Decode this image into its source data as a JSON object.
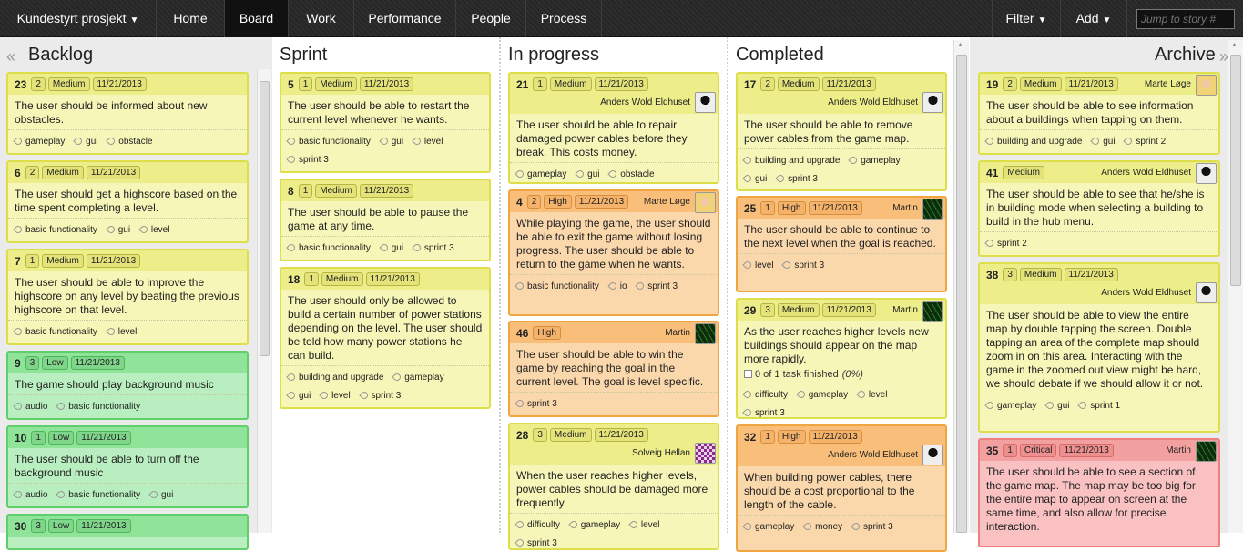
{
  "nav": {
    "project": "Kundestyrt prosjekt",
    "items": [
      "Home",
      "Board",
      "Work",
      "Performance",
      "People",
      "Process"
    ],
    "filter": "Filter",
    "add": "Add",
    "jump_placeholder": "Jump to story #"
  },
  "columns": {
    "backlog": "Backlog",
    "sprint": "Sprint",
    "in_progress": "In progress",
    "completed": "Completed",
    "archive": "Archive"
  },
  "colors": {
    "yellow": "#f6f6b8",
    "orange": "#fbd8ac",
    "green": "#b9efc0",
    "red": "#f9c1c1",
    "nav": "#2a2a2a"
  },
  "backlog": [
    {
      "id": "23",
      "points": "2",
      "priority": "Medium",
      "date": "11/21/2013",
      "text": "The user should be informed about new obstacles.",
      "tags": [
        "gameplay",
        "gui",
        "obstacle"
      ]
    },
    {
      "id": "6",
      "points": "2",
      "priority": "Medium",
      "date": "11/21/2013",
      "text": "The user should get a highscore based on the time spent completing a level.",
      "tags": [
        "basic functionality",
        "gui",
        "level"
      ]
    },
    {
      "id": "7",
      "points": "1",
      "priority": "Medium",
      "date": "11/21/2013",
      "text": "The user should be able to improve the highscore on any level by beating the previous highscore on that level.",
      "tags": [
        "basic functionality",
        "level"
      ]
    },
    {
      "id": "9",
      "points": "3",
      "priority": "Low",
      "date": "11/21/2013",
      "text": "The game should play background music",
      "tags": [
        "audio",
        "basic functionality"
      ]
    },
    {
      "id": "10",
      "points": "1",
      "priority": "Low",
      "date": "11/21/2013",
      "text": "The user should be able to turn off the background music",
      "tags": [
        "audio",
        "basic functionality",
        "gui"
      ]
    },
    {
      "id": "30",
      "points": "3",
      "priority": "Low",
      "date": "11/21/2013",
      "text": "",
      "tags": []
    }
  ],
  "sprint": [
    {
      "id": "5",
      "points": "1",
      "priority": "Medium",
      "date": "11/21/2013",
      "text": "The user should be able to restart the current level whenever he wants.",
      "tags": [
        "basic functionality",
        "gui",
        "level",
        "sprint 3"
      ]
    },
    {
      "id": "8",
      "points": "1",
      "priority": "Medium",
      "date": "11/21/2013",
      "text": "The user should be able to pause the game at any time.",
      "tags": [
        "basic functionality",
        "gui",
        "sprint 3"
      ]
    },
    {
      "id": "18",
      "points": "1",
      "priority": "Medium",
      "date": "11/21/2013",
      "text": "The user should only be allowed to build a certain number of power stations depending on the level. The user should be told how many power stations he can build.",
      "tags": [
        "building and upgrade",
        "gameplay",
        "gui",
        "level",
        "sprint 3"
      ]
    }
  ],
  "in_progress": [
    {
      "id": "21",
      "points": "1",
      "priority": "Medium",
      "date": "11/21/2013",
      "assignee": "Anders Wold Eldhuset",
      "avatar": "anders",
      "text": "The user should be able to repair damaged power cables before they break. This costs money.",
      "tags": [
        "gameplay",
        "gui",
        "obstacle",
        "sprint 3"
      ]
    },
    {
      "id": "4",
      "points": "2",
      "priority": "High",
      "date": "11/21/2013",
      "assignee": "Marte Løge",
      "avatar": "marte",
      "text": "While playing the game, the user should be able to exit the game without losing progress. The user should be able to return to the game when he wants.",
      "tags": [
        "basic functionality",
        "io",
        "sprint 3"
      ]
    },
    {
      "id": "46",
      "priority": "High",
      "assignee": "Martin",
      "avatar": "martin",
      "text": "The user should be able to win the game by reaching the goal in the current level. The goal is level specific.",
      "tags": [
        "sprint 3"
      ]
    },
    {
      "id": "28",
      "points": "3",
      "priority": "Medium",
      "date": "11/21/2013",
      "assignee": "Solveig Hellan",
      "avatar": "solveig",
      "text": "When the user reaches higher levels, power cables should be damaged more frequently.",
      "tags": [
        "difficulty",
        "gameplay",
        "level",
        "sprint 3"
      ]
    }
  ],
  "completed": [
    {
      "id": "17",
      "points": "2",
      "priority": "Medium",
      "date": "11/21/2013",
      "assignee": "Anders Wold Eldhuset",
      "avatar": "anders",
      "text": "The user should be able to remove power cables from the game map.",
      "tags": [
        "building and upgrade",
        "gameplay",
        "gui",
        "sprint 3"
      ]
    },
    {
      "id": "25",
      "points": "1",
      "priority": "High",
      "date": "11/21/2013",
      "assignee": "Martin",
      "avatar": "martin",
      "text": "The user should be able to continue to the next level when the goal is reached.",
      "tags": [
        "level",
        "sprint 3"
      ]
    },
    {
      "id": "29",
      "points": "3",
      "priority": "Medium",
      "date": "11/21/2013",
      "assignee": "Martin",
      "avatar": "martin",
      "text": "As the user reaches higher levels new buildings should appear on the map more rapidly.",
      "tasks": "0 of 1 task finished",
      "tasks_pct": "(0%)",
      "tags": [
        "difficulty",
        "gameplay",
        "level",
        "sprint 3"
      ]
    },
    {
      "id": "32",
      "points": "1",
      "priority": "High",
      "date": "11/21/2013",
      "assignee": "Anders Wold Eldhuset",
      "avatar": "anders",
      "text": "When building power cables, there should be a cost proportional to the length of the cable.",
      "tags": [
        "gameplay",
        "money",
        "sprint 3"
      ]
    }
  ],
  "archive": [
    {
      "id": "19",
      "points": "2",
      "priority": "Medium",
      "date": "11/21/2013",
      "assignee": "Marte Løge",
      "avatar": "marte",
      "text": "The user should be able to see information about a buildings when tapping on them.",
      "tags": [
        "building and upgrade",
        "gui",
        "sprint 2"
      ]
    },
    {
      "id": "41",
      "priority": "Medium",
      "assignee": "Anders Wold Eldhuset",
      "avatar": "anders",
      "text": "The user should be able to see that he/she is in building mode when selecting a building to build in the hub menu.",
      "tags": [
        "sprint 2"
      ]
    },
    {
      "id": "38",
      "points": "3",
      "priority": "Medium",
      "date": "11/21/2013",
      "assignee": "Anders Wold Eldhuset",
      "avatar": "anders",
      "text": "The user should be able to view the entire map by double tapping the screen. Double tapping an area of the complete map should zoom in on this area. Interacting with the game in the zoomed out view might be hard, we should debate if we should allow it or not.",
      "tags": [
        "gameplay",
        "gui",
        "sprint 1"
      ]
    },
    {
      "id": "35",
      "points": "1",
      "priority": "Critical",
      "date": "11/21/2013",
      "assignee": "Martin",
      "avatar": "martin",
      "text": "The user should be able to see a section of the game map. The map may be too big for the entire map to appear on screen at the same time, and also allow for precise interaction.",
      "tags": []
    }
  ]
}
